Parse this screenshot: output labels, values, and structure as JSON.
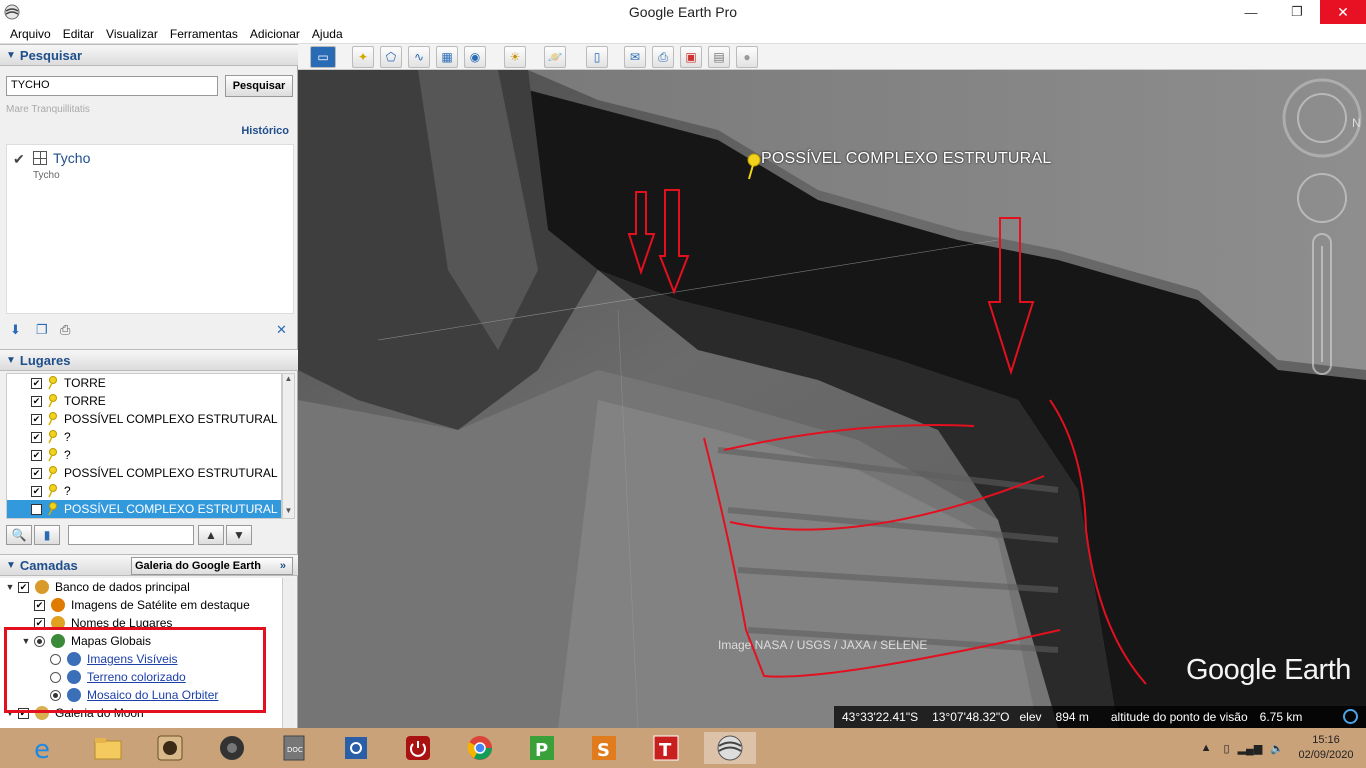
{
  "window": {
    "title": "Google Earth Pro",
    "minimize": "—",
    "maximize": "❐",
    "close": "✕"
  },
  "menu": [
    "Arquivo",
    "Editar",
    "Visualizar",
    "Ferramentas",
    "Adicionar",
    "Ajuda"
  ],
  "search": {
    "header": "Pesquisar",
    "input_value": "TYCHO",
    "button": "Pesquisar",
    "hint": "Mare Tranquillitatis",
    "history": "Histórico",
    "result_title": "Tycho",
    "result_sub": "Tycho"
  },
  "places": {
    "header": "Lugares",
    "items": [
      {
        "label": "TORRE",
        "selected": false
      },
      {
        "label": "TORRE",
        "selected": false
      },
      {
        "label": "POSSÍVEL COMPLEXO ESTRUTURAL",
        "selected": false
      },
      {
        "label": "?",
        "selected": false
      },
      {
        "label": "?",
        "selected": false
      },
      {
        "label": "POSSÍVEL COMPLEXO ESTRUTURAL",
        "selected": false
      },
      {
        "label": "?",
        "selected": false
      },
      {
        "label": "POSSÍVEL COMPLEXO ESTRUTURAL",
        "selected": true
      }
    ]
  },
  "layers": {
    "header": "Camadas",
    "gallery_button": "Galeria do Google Earth",
    "items": [
      {
        "label": "Banco de dados principal",
        "indent": 0,
        "kind": "checkbox-root"
      },
      {
        "label": "Imagens de Satélite em destaque",
        "indent": 1,
        "kind": "checkbox"
      },
      {
        "label": "Nomes de Lugares",
        "indent": 1,
        "kind": "checkbox"
      },
      {
        "label": "Mapas Globais",
        "indent": 1,
        "kind": "radio-root"
      },
      {
        "label": "Imagens Visíveis",
        "indent": 2,
        "kind": "radio-link",
        "on": false
      },
      {
        "label": "Terreno colorizado",
        "indent": 2,
        "kind": "radio-link",
        "on": false
      },
      {
        "label": "Mosaico do Luna Orbiter",
        "indent": 2,
        "kind": "radio-link",
        "on": true
      },
      {
        "label": "Galeria do Moon",
        "indent": 0,
        "kind": "checkbox-root"
      }
    ]
  },
  "map": {
    "placemark_label": "POSSÍVEL COMPLEXO ESTRUTURAL",
    "credit": "Image NASA / USGS / JAXA / SELENE",
    "logo": "Google Earth",
    "status": {
      "lat": "43°33'22.41\"S",
      "lon": "13°07'48.32\"O",
      "elev_label": "elev",
      "elev_value": "894 m",
      "alt_label": "altitude do ponto de visão",
      "alt_value": "6.75 km"
    },
    "annotation_color": "#e3101f"
  },
  "taskbar": {
    "time": "15:16",
    "date": "02/09/2020"
  }
}
